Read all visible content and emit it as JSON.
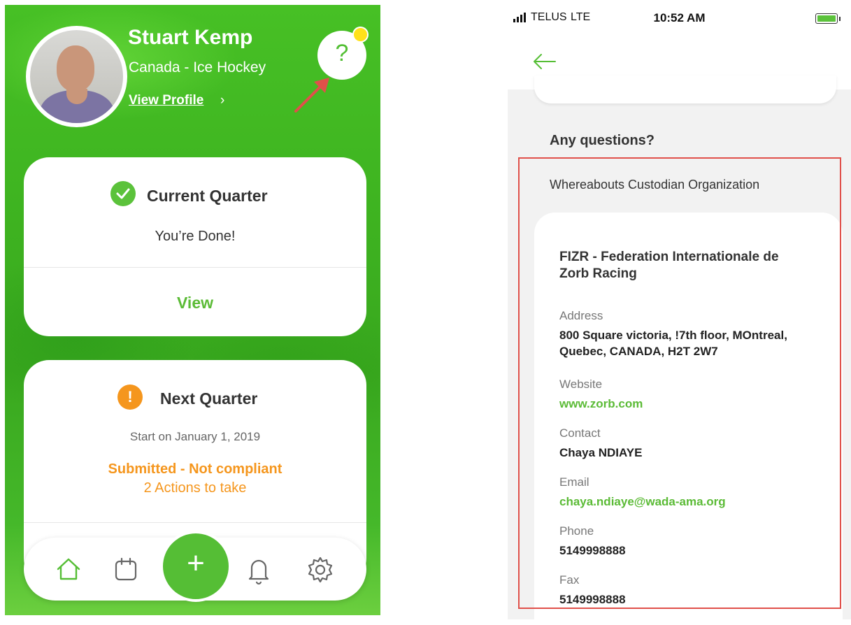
{
  "left": {
    "profile": {
      "name": "Stuart Kemp",
      "sport": "Canada - Ice Hockey",
      "view_profile": "View Profile",
      "chevron": "›"
    },
    "help": {
      "label": "?"
    },
    "current_quarter": {
      "title": "Current Quarter",
      "status": "You’re Done!",
      "action": "View"
    },
    "next_quarter": {
      "title": "Next Quarter",
      "start": "Start on January 1, 2019",
      "submitted": "Submitted - Not compliant",
      "actions": "2 Actions to take",
      "warning_symbol": "!"
    },
    "tabbar": {
      "items": [
        "home-icon",
        "calendar-icon",
        "add-icon",
        "bell-icon",
        "settings-icon"
      ],
      "fab_label": "+"
    }
  },
  "right": {
    "statusbar": {
      "carrier": "TELUS",
      "network": "LTE",
      "time": "10:52 AM"
    },
    "section_title": "Any questions?",
    "organization_type": "Whereabouts Custodian Organization",
    "organization_name": "FIZR - Federation Internationale de Zorb Racing",
    "address": {
      "label": "Address",
      "value": "800 Square victoria, !7th floor, MOntreal, Quebec, CANADA, H2T 2W7"
    },
    "website": {
      "label": "Website",
      "value": "www.zorb.com"
    },
    "contact": {
      "label": "Contact",
      "value": "Chaya NDIAYE"
    },
    "email": {
      "label": "Email",
      "value": "chaya.ndiaye@wada-ama.org"
    },
    "phone": {
      "label": "Phone",
      "value": "5149998888"
    },
    "fax": {
      "label": "Fax",
      "value": "5149998888"
    }
  },
  "colors": {
    "brand_green": "#55be35",
    "warning_orange": "#f5961d",
    "notification_yellow": "#ffe11a",
    "annotation_red": "#e0504a"
  }
}
